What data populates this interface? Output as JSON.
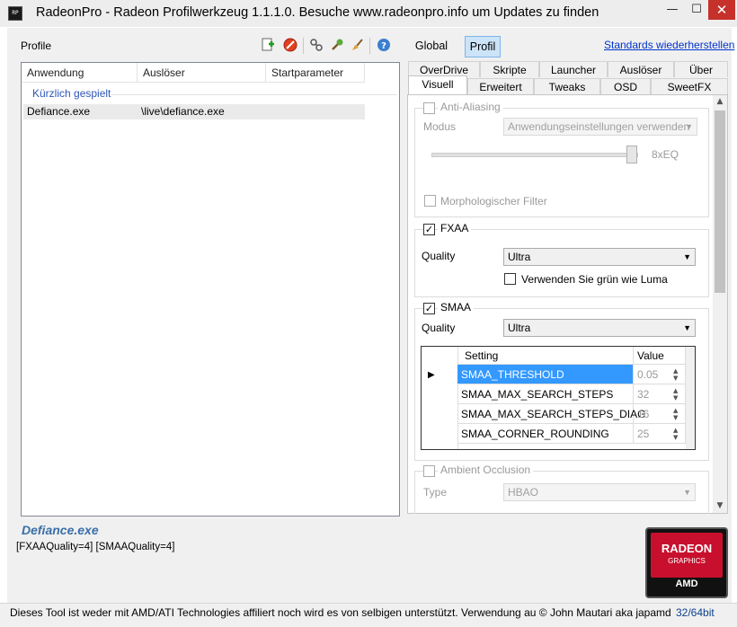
{
  "window": {
    "icon_text": "RP",
    "title": "RadeonPro - Radeon Profilwerkzeug 1.1.1.0. Besuche www.radeonpro.info um Updates zu finden",
    "min": "—",
    "max": "☐",
    "close": "✕"
  },
  "left": {
    "profile_label": "Profile",
    "toolbar_icons": [
      "add-profile-icon",
      "delete-profile-icon",
      "link-icon",
      "tools-icon",
      "clean-icon",
      "help-icon"
    ],
    "columns": [
      "Anwendung",
      "Auslöser",
      "Startparameter"
    ],
    "group_label": "Kürzlich gespielt",
    "rows": [
      {
        "app": "Defiance.exe",
        "trigger": "\\live\\defiance.exe",
        "params": ""
      }
    ],
    "profile_name": "Defiance.exe",
    "profile_params": "[FXAAQuality=4] [SMAAQuality=4]"
  },
  "right": {
    "global_label": "Global",
    "profil_label": "Profil",
    "reset_link": "Standards wiederherstellen",
    "tabs_row1": [
      "OverDrive",
      "Skripte",
      "Launcher",
      "Auslöser",
      "Über"
    ],
    "tabs_row2": [
      "Visuell",
      "Erweitert",
      "Tweaks",
      "OSD",
      "SweetFX"
    ],
    "active_tab": "Visuell",
    "aa": {
      "label": "Anti-Aliasing",
      "mode_label": "Modus",
      "mode_value": "Anwendungseinstellungen verwenden",
      "slider_value": "8xEQ",
      "morph_label": "Morphologischer Filter"
    },
    "fxaa": {
      "label": "FXAA",
      "checked": true,
      "quality_label": "Quality",
      "quality_value": "Ultra",
      "luma_label": "Verwenden Sie grün wie Luma"
    },
    "smaa": {
      "label": "SMAA",
      "checked": true,
      "quality_label": "Quality",
      "quality_value": "Ultra",
      "grid_headers": [
        "Setting",
        "Value"
      ],
      "grid_rows": [
        {
          "setting": "SMAA_THRESHOLD",
          "value": "0.05"
        },
        {
          "setting": "SMAA_MAX_SEARCH_STEPS",
          "value": "32"
        },
        {
          "setting": "SMAA_MAX_SEARCH_STEPS_DIAG",
          "value": "16"
        },
        {
          "setting": "SMAA_CORNER_ROUNDING",
          "value": "25"
        }
      ]
    },
    "ao": {
      "label": "Ambient Occlusion",
      "type_label": "Type",
      "type_value": "HBAO"
    }
  },
  "logo": {
    "line1": "RADEON",
    "line2": "GRAPHICS",
    "line3": "AMD"
  },
  "status": {
    "text": "Dieses Tool ist weder mit AMD/ATI Technologies affiliert noch wird es von selbigen unterstützt. Verwendung au",
    "author": "© John Mautari aka japamd",
    "bits": "32/64bit"
  },
  "colors": {
    "accent": "#3a6fa8",
    "selection": "#3399ff",
    "logo_red": "#c8102e"
  }
}
